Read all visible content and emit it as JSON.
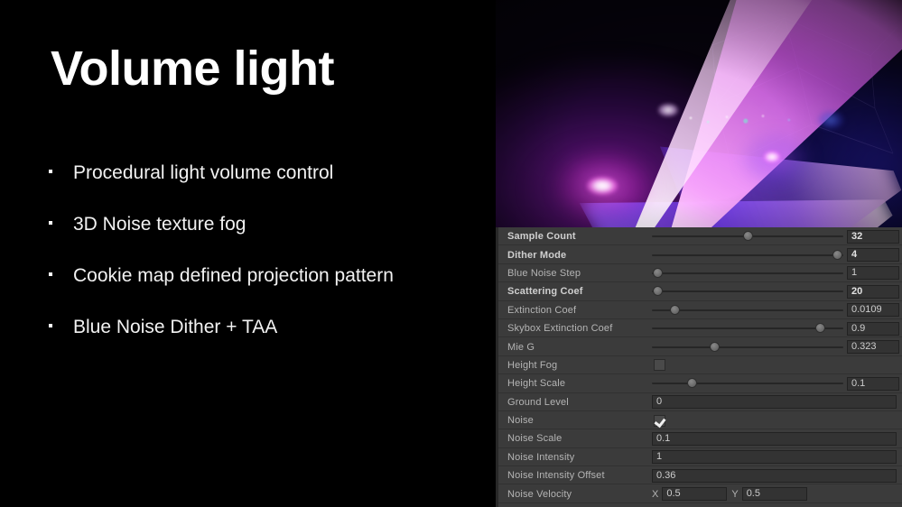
{
  "slide": {
    "title": "Volume light",
    "bullet_marker": "bullet-square",
    "bullets": [
      "Procedural light volume control",
      "3D Noise texture fog",
      "Cookie map defined projection pattern",
      "Blue Noise Dither + TAA"
    ]
  },
  "preview": {
    "caption_none": "",
    "description": "Volumetric spotlight render: magenta cone and blue cone on dark stage",
    "colors": {
      "magenta": "#e85ffa",
      "blue": "#5a3cf5",
      "violet": "#9b5aff",
      "background": "#06030c"
    }
  },
  "inspector": {
    "panel_bg": "#3b3b3b",
    "label_color": "#b4b4b4",
    "field_bg": "#333333",
    "rows": [
      {
        "label": "Sample Count",
        "bold": true,
        "control": "slider",
        "value": "32",
        "fill": 0.5
      },
      {
        "label": "Dither Mode",
        "bold": true,
        "control": "slider",
        "value": "4",
        "fill": 0.97
      },
      {
        "label": "Blue Noise Step",
        "bold": false,
        "control": "slider",
        "value": "1",
        "fill": 0.03
      },
      {
        "label": "Scattering Coef",
        "bold": true,
        "control": "slider",
        "value": "20",
        "fill": 0.03
      },
      {
        "label": "Extinction Coef",
        "bold": false,
        "control": "slider",
        "value": "0.0109",
        "fill": 0.12
      },
      {
        "label": "Skybox Extinction Coef",
        "bold": false,
        "control": "slider",
        "value": "0.9",
        "fill": 0.88
      },
      {
        "label": "Mie G",
        "bold": false,
        "control": "slider",
        "value": "0.323",
        "fill": 0.33
      },
      {
        "label": "Height Fog",
        "bold": false,
        "control": "checkbox",
        "checked": false
      },
      {
        "label": "Height Scale",
        "bold": false,
        "control": "slider",
        "value": "0.1",
        "fill": 0.21
      },
      {
        "label": "Ground Level",
        "bold": false,
        "control": "text",
        "value": "0"
      },
      {
        "label": "Noise",
        "bold": false,
        "control": "checkbox",
        "checked": true
      },
      {
        "label": "Noise Scale",
        "bold": false,
        "control": "text",
        "value": "0.1"
      },
      {
        "label": "Noise Intensity",
        "bold": false,
        "control": "text",
        "value": "1"
      },
      {
        "label": "Noise Intensity Offset",
        "bold": false,
        "control": "text",
        "value": "0.36"
      },
      {
        "label": "Noise Velocity",
        "bold": false,
        "control": "vector2",
        "axes": [
          {
            "axis": "X",
            "value": "0.5"
          },
          {
            "axis": "Y",
            "value": "0.5"
          }
        ]
      }
    ]
  }
}
